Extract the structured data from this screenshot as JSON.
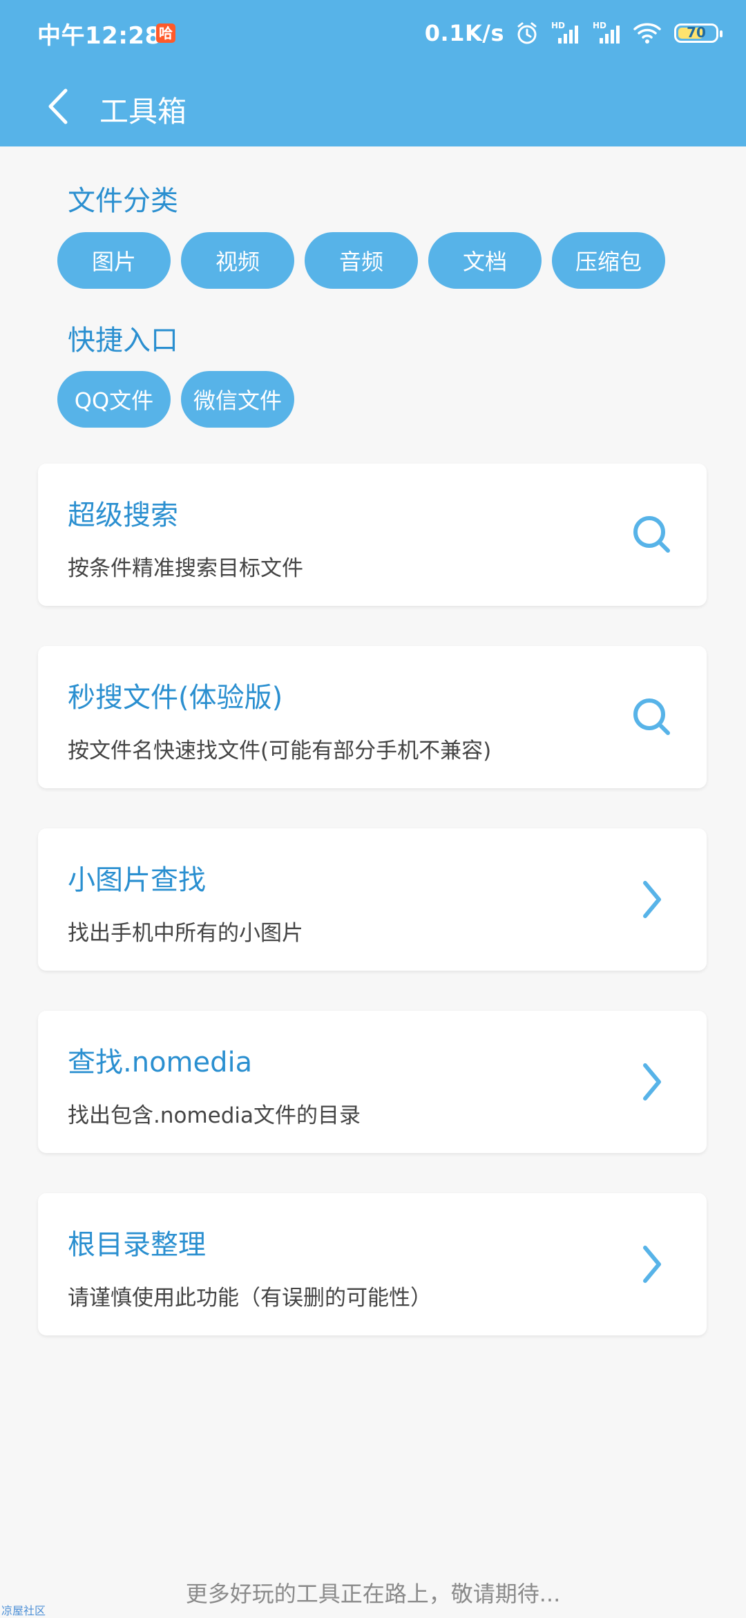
{
  "status": {
    "time": "中午12:28",
    "app_badge": "哈",
    "net_speed": "0.1K/s",
    "battery": "70",
    "battery_level": 0.7
  },
  "toolbar": {
    "title": "工具箱",
    "back_icon": "chevron-left-icon"
  },
  "file_categories": {
    "title": "文件分类",
    "items": [
      "图片",
      "视频",
      "音频",
      "文档",
      "压缩包"
    ]
  },
  "quick_entry": {
    "title": "快捷入口",
    "items": [
      "QQ文件",
      "微信文件"
    ]
  },
  "tools": [
    {
      "title": "超级搜索",
      "subtitle": "按条件精准搜索目标文件",
      "icon": "search-icon"
    },
    {
      "title": "秒搜文件(体验版)",
      "subtitle": "按文件名快速找文件(可能有部分手机不兼容)",
      "icon": "search-icon"
    },
    {
      "title": "小图片查找",
      "subtitle": "找出手机中所有的小图片",
      "icon": "chevron-right-icon"
    },
    {
      "title": "查找.nomedia",
      "subtitle": "找出包含.nomedia文件的目录",
      "icon": "chevron-right-icon"
    },
    {
      "title": "根目录整理",
      "subtitle": "请谨慎使用此功能（有误删的可能性）",
      "icon": "chevron-right-icon"
    }
  ],
  "footer": {
    "text": "更多好玩的工具正在路上，敬请期待..."
  },
  "watermark": "凉屋社区",
  "colors": {
    "primary": "#57b3e8",
    "title_text": "#2a8fd0",
    "background": "#f7f7f7"
  }
}
